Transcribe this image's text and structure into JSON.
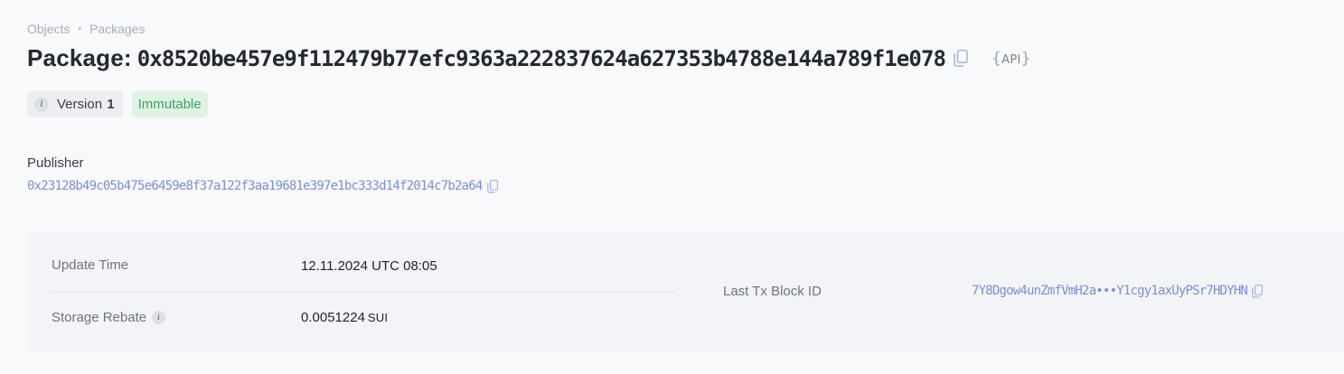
{
  "breadcrumb": {
    "items": [
      "Objects",
      "Packages"
    ],
    "separator": "•"
  },
  "header": {
    "title_prefix": "Package:",
    "package_id": "0x8520be457e9f112479b77efc9363a222837624a627353b4788e144a789f1e078",
    "api_label": "API"
  },
  "badges": {
    "version_label": "Version",
    "version_number": "1",
    "status": "Immutable"
  },
  "publisher": {
    "label": "Publisher",
    "address": "0x23128b49c05b475e6459e8f37a122f3aa19681e397e1bc333d14f2014c7b2a64"
  },
  "details": {
    "update_time_label": "Update Time",
    "update_time_value": "12.11.2024 UTC 08:05",
    "storage_rebate_label": "Storage Rebate",
    "storage_rebate_value": "0.0051224",
    "storage_rebate_unit": "SUI",
    "last_tx_label": "Last Tx Block ID",
    "last_tx_value": "7Y8Dgow4unZmfVmH2a•••Y1cgy1axUyPSr7HDYHN"
  },
  "icons": {
    "copy": "copy-icon",
    "info": "info-icon"
  },
  "colors": {
    "link": "#7b8fd6",
    "immutable_bg": "#dff3e3",
    "immutable_text": "#3ea363",
    "background": "#f8f9fb",
    "panel": "#f3f4f7"
  }
}
